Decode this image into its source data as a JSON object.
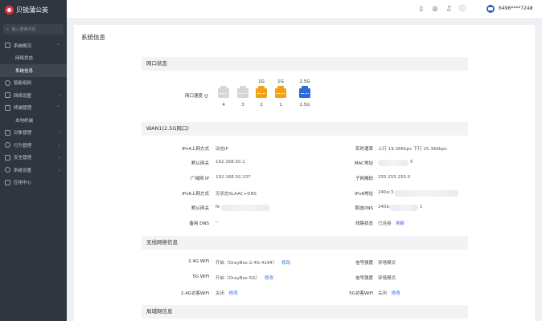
{
  "app": {
    "title": "贝锐蒲公英"
  },
  "search": {
    "placeholder": "输入搜索内容"
  },
  "sidebar": {
    "items": [
      {
        "label": "系统概况",
        "expanded": true,
        "subs": [
          "网络状态",
          "系统信息"
        ],
        "active_sub": "系统信息"
      },
      {
        "label": "智能组网"
      },
      {
        "label": "网络设置"
      },
      {
        "label": "终端管理",
        "expanded": true,
        "subs": [
          "本地终端"
        ]
      },
      {
        "label": "对象管理"
      },
      {
        "label": "行为管理"
      },
      {
        "label": "安全管理"
      },
      {
        "label": "系统设置"
      },
      {
        "label": "应用中心"
      }
    ]
  },
  "header": {
    "username": "6496****7242",
    "caret": "▾"
  },
  "page": {
    "title": "系统信息"
  },
  "port_section": {
    "title": "网口状态",
    "speed_label": "网口速度",
    "ports": [
      {
        "num": "4",
        "speed": "",
        "color": "#d4d6d9"
      },
      {
        "num": "3",
        "speed": "",
        "color": "#d4d6d9"
      },
      {
        "num": "2",
        "speed": "1G",
        "color": "#f2a11b"
      },
      {
        "num": "1",
        "speed": "1G",
        "color": "#f2a11b"
      },
      {
        "num": "2.5G",
        "speed": "2.5G",
        "color": "#2f6bd8"
      }
    ]
  },
  "wan": {
    "title": "WAN1(2.5G网口)",
    "left": [
      {
        "label": "IPv4上网方式",
        "value": "动态IP"
      },
      {
        "label": "默认网关",
        "value": "192.168.50.1"
      },
      {
        "label": "广域网 IP",
        "value": "192.168.50.237"
      },
      {
        "label": "IPv6上网方式",
        "value": "无状态SLAAC+DNS"
      },
      {
        "label": "默认网关",
        "value": "fe"
      },
      {
        "label": "备用 DNS",
        "value": "--"
      }
    ],
    "right": [
      {
        "label": "实时速率",
        "value": "上行 19.36Kbps  下行 25.36Kbps"
      },
      {
        "label": "MAC地址",
        "value": "5"
      },
      {
        "label": "子网掩码",
        "value": "255.255.255.0"
      },
      {
        "label": "IPv6地址",
        "value": "240e:3"
      },
      {
        "label": "首选DNS",
        "value": "240e:",
        "suffix": "1"
      },
      {
        "label": "线路状态",
        "value": "已连接",
        "link": "刷新"
      }
    ]
  },
  "wireless": {
    "title": "无线网络信息",
    "left": [
      {
        "label": "2.4G WiFi",
        "value": "开启（OrayBox-2.4G-4194）",
        "link": "修改"
      },
      {
        "label": "5G WiFi",
        "value": "开启（OrayBox-5G）",
        "link": "修改"
      },
      {
        "label": "2.4G访客WiFi",
        "value": "关闭",
        "link": "修改"
      }
    ],
    "right": [
      {
        "label": "信号强度",
        "value": "穿墙模式"
      },
      {
        "label": "信号强度",
        "value": "穿墙模式"
      },
      {
        "label": "5G访客WiFi",
        "value": "关闭",
        "link": "修改"
      }
    ]
  },
  "lan": {
    "title": "局域网信息"
  },
  "icons": [
    "phone-icon",
    "headset-icon",
    "bell-icon",
    "help-icon",
    "avatar"
  ]
}
